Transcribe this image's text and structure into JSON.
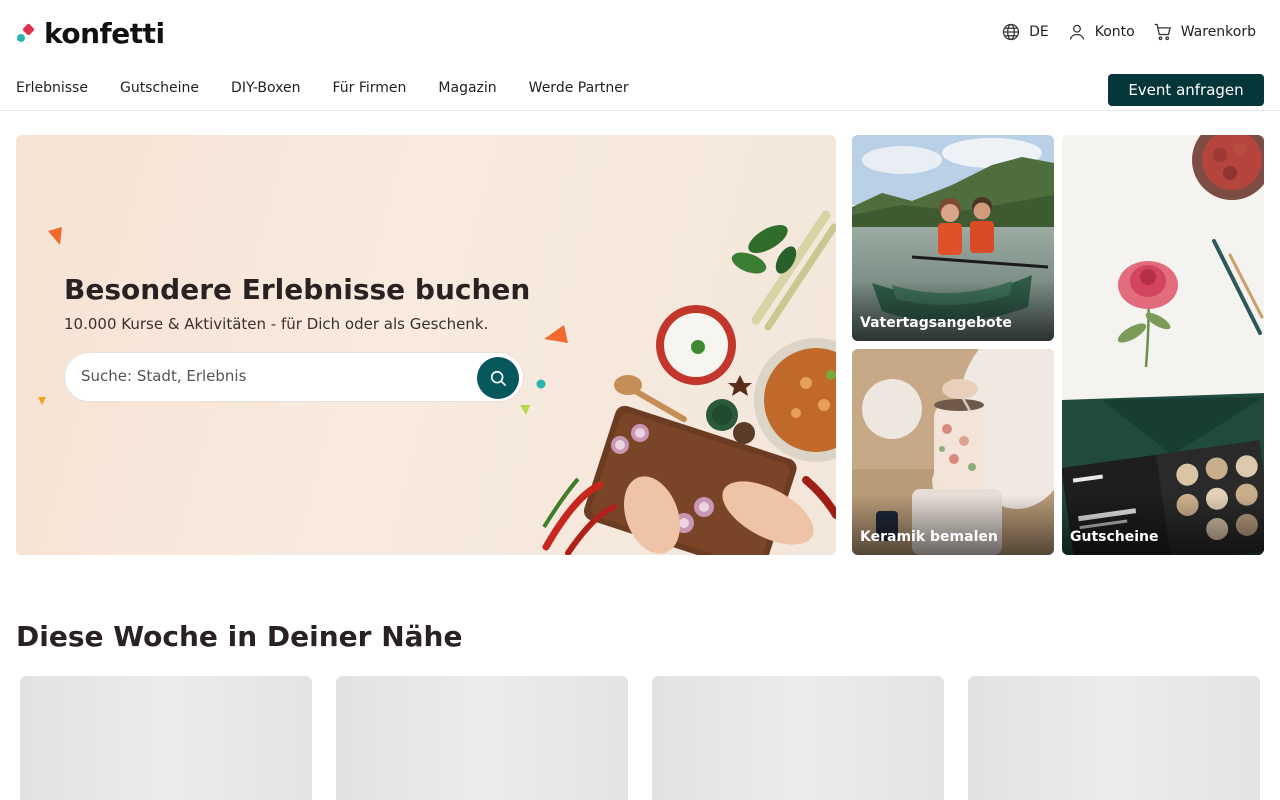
{
  "brand": {
    "name": "konfetti"
  },
  "header": {
    "language": "DE",
    "account": "Konto",
    "cart": "Warenkorb",
    "nav": [
      "Erlebnisse",
      "Gutscheine",
      "DIY-Boxen",
      "Für Firmen",
      "Magazin",
      "Werde Partner"
    ],
    "cta": "Event anfragen"
  },
  "hero": {
    "title": "Besondere Erlebnisse buchen",
    "subtitle": "10.000 Kurse & Aktivitäten - für Dich oder als Geschenk.",
    "search_placeholder": "Suche: Stadt, Erlebnis"
  },
  "tiles": [
    {
      "label": "Vatertagsangebote"
    },
    {
      "label": "Keramik bemalen"
    },
    {
      "label": "Gutscheine"
    }
  ],
  "section": {
    "title": "Diese Woche in Deiner Nähe"
  },
  "colors": {
    "primary": "#05363a",
    "search_button": "#07585c",
    "logo_red": "#e0304a",
    "logo_teal": "#2bb3b1"
  }
}
